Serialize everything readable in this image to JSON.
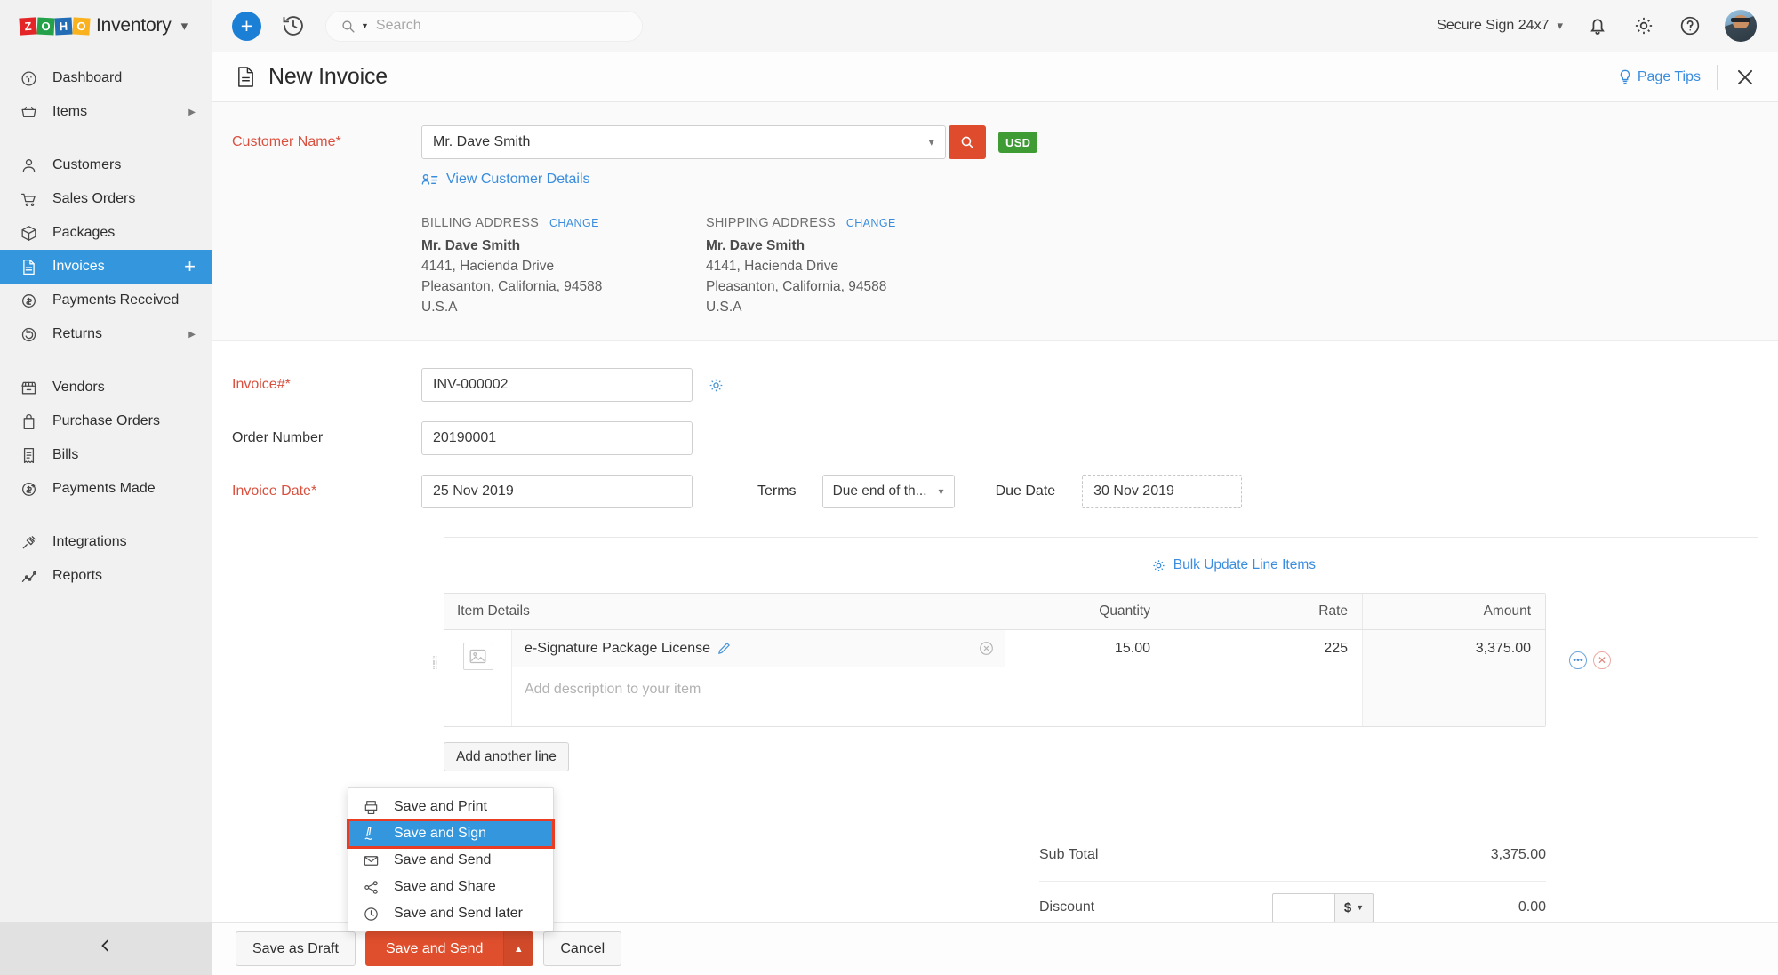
{
  "topbar": {
    "brand": {
      "z": "Z",
      "o1": "O",
      "h": "H",
      "o2": "O",
      "name": "Inventory"
    },
    "search_placeholder": "Search",
    "org_name": "Secure Sign 24x7",
    "icons": {
      "add": "plus-icon",
      "recent": "clock-history-icon",
      "search": "search-icon",
      "notifications": "bell-icon",
      "settings": "gear-icon",
      "help": "question-mark-icon",
      "profile": "user-avatar"
    }
  },
  "sidebar": {
    "items": [
      {
        "label": "Dashboard",
        "icon": "dashboard-icon",
        "arrow": false,
        "plus": false,
        "active": false
      },
      {
        "label": "Items",
        "icon": "basket-icon",
        "arrow": true,
        "plus": false,
        "active": false
      },
      {
        "label": "Customers",
        "icon": "person-icon",
        "arrow": false,
        "plus": false,
        "active": false
      },
      {
        "label": "Sales Orders",
        "icon": "cart-icon",
        "arrow": false,
        "plus": false,
        "active": false
      },
      {
        "label": "Packages",
        "icon": "box-icon",
        "arrow": false,
        "plus": false,
        "active": false
      },
      {
        "label": "Invoices",
        "icon": "invoice-icon",
        "arrow": false,
        "plus": true,
        "active": true
      },
      {
        "label": "Payments Received",
        "icon": "payment-in-icon",
        "arrow": false,
        "plus": false,
        "active": false
      },
      {
        "label": "Returns",
        "icon": "return-icon",
        "arrow": true,
        "plus": false,
        "active": false
      },
      {
        "label": "Vendors",
        "icon": "store-icon",
        "arrow": false,
        "plus": false,
        "active": false
      },
      {
        "label": "Purchase Orders",
        "icon": "bag-icon",
        "arrow": false,
        "plus": false,
        "active": false
      },
      {
        "label": "Bills",
        "icon": "receipt-icon",
        "arrow": false,
        "plus": false,
        "active": false
      },
      {
        "label": "Payments Made",
        "icon": "payment-out-icon",
        "arrow": false,
        "plus": false,
        "active": false
      },
      {
        "label": "Integrations",
        "icon": "plug-icon",
        "arrow": false,
        "plus": false,
        "active": false
      },
      {
        "label": "Reports",
        "icon": "chart-icon",
        "arrow": false,
        "plus": false,
        "active": false
      }
    ],
    "gap_after": [
      1,
      7,
      11
    ]
  },
  "page_header": {
    "title": "New Invoice",
    "page_tips": "Page Tips",
    "close": "×"
  },
  "form": {
    "customer": {
      "label": "Customer Name*",
      "value": "Mr. Dave Smith",
      "currency_badge": "USD",
      "view_details": "View Customer Details"
    },
    "billing": {
      "title": "BILLING ADDRESS",
      "change": "CHANGE",
      "name": "Mr. Dave Smith",
      "line1": "4141, Hacienda Drive",
      "line2": "Pleasanton, California, 94588",
      "line3": "U.S.A"
    },
    "shipping": {
      "title": "SHIPPING ADDRESS",
      "change": "CHANGE",
      "name": "Mr. Dave Smith",
      "line1": "4141, Hacienda Drive",
      "line2": "Pleasanton, California, 94588",
      "line3": "U.S.A"
    },
    "invoice_number": {
      "label": "Invoice#*",
      "value": "INV-000002"
    },
    "order_number": {
      "label": "Order Number",
      "value": "20190001"
    },
    "invoice_date": {
      "label": "Invoice Date*",
      "value": "25 Nov 2019"
    },
    "terms": {
      "label": "Terms",
      "value": "Due end of th..."
    },
    "due_date": {
      "label": "Due Date",
      "value": "30 Nov 2019"
    },
    "bulk_update": "Bulk Update Line Items",
    "add_another_line": "Add another line"
  },
  "line_items": {
    "columns": [
      "Item Details",
      "Quantity",
      "Rate",
      "Amount"
    ],
    "rows": [
      {
        "name": "e-Signature Package License",
        "description_placeholder": "Add description to your item",
        "quantity": "15.00",
        "rate": "225",
        "amount": "3,375.00"
      }
    ]
  },
  "totals": {
    "sub_total_label": "Sub Total",
    "sub_total_value": "3,375.00",
    "discount_label": "Discount",
    "discount_value": "",
    "discount_unit": "$",
    "discount_amount": "0.00"
  },
  "save_menu": {
    "items": [
      {
        "label": "Save and Print",
        "icon": "printer-icon",
        "selected": false
      },
      {
        "label": "Save and Sign",
        "icon": "signature-pen-icon",
        "selected": true
      },
      {
        "label": "Save and Send",
        "icon": "envelope-icon",
        "selected": false
      },
      {
        "label": "Save and Share",
        "icon": "share-icon",
        "selected": false
      },
      {
        "label": "Save and Send later",
        "icon": "clock-icon",
        "selected": false
      }
    ]
  },
  "bottombar": {
    "save_draft": "Save as Draft",
    "save_send": "Save and Send",
    "cancel": "Cancel"
  },
  "colors": {
    "accent_blue": "#3497de",
    "link_blue": "#3a8dde",
    "primary_red": "#df4f2d",
    "required_red": "#d9503f",
    "highlight_outline": "#ea3c23",
    "currency_green": "#3f9c35"
  }
}
